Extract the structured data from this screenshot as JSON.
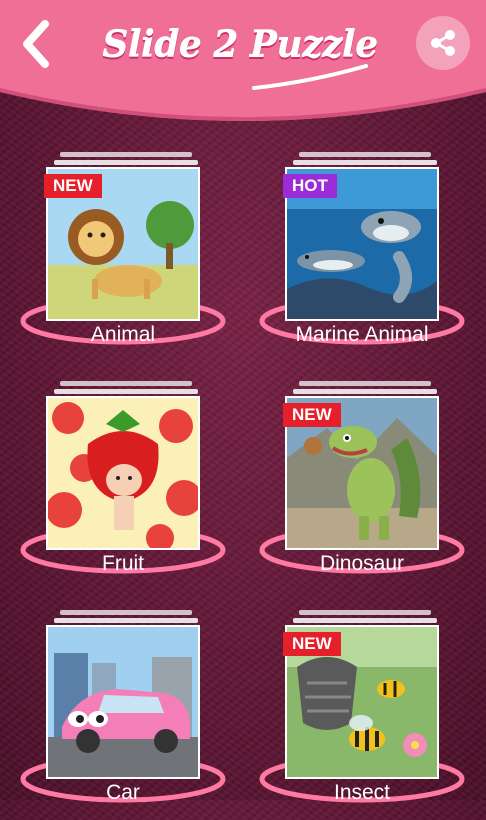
{
  "header": {
    "title": "Slide 2 Puzzle",
    "back_icon": "chevron-left-icon",
    "share_icon": "share-icon",
    "bar_color": "#ef6f97",
    "badge_new_color": "#e6202a",
    "badge_hot_color": "#9c2cd8"
  },
  "categories": [
    {
      "label": "Animal",
      "badge": "NEW",
      "image": "lion-cartoon"
    },
    {
      "label": "Marine Animal",
      "badge": "HOT",
      "image": "dolphins-cartoon"
    },
    {
      "label": "Fruit",
      "badge": "",
      "image": "strawberry-character"
    },
    {
      "label": "Dinosaur",
      "badge": "NEW",
      "image": "dinosaur-cartoon"
    },
    {
      "label": "Car",
      "badge": "",
      "image": "pink-car-cartoon"
    },
    {
      "label": "Insect",
      "badge": "NEW",
      "image": "bees-cartoon"
    }
  ]
}
